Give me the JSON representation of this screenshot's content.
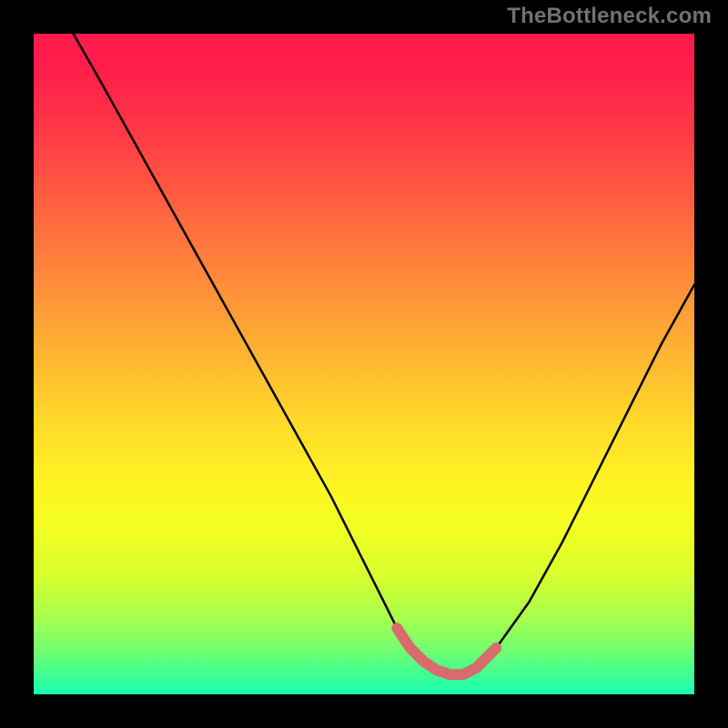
{
  "watermark": "TheBottleneck.com",
  "colors": {
    "background": "#000000",
    "curve": "#000000",
    "valley_marker": "#d86b6b",
    "gradient_top": "#ff1a4d",
    "gradient_mid": "#fff423",
    "gradient_bottom": "#18ffb0",
    "watermark": "#707172"
  },
  "chart_data": {
    "type": "line",
    "title": "",
    "xlabel": "",
    "ylabel": "",
    "xlim": [
      0,
      100
    ],
    "ylim": [
      0,
      100
    ],
    "grid": false,
    "legend": false,
    "series": [
      {
        "name": "bottleneck-curve",
        "x": [
          6,
          10,
          15,
          20,
          25,
          30,
          35,
          40,
          45,
          50,
          53,
          55,
          57,
          60,
          63,
          65,
          67,
          70,
          75,
          80,
          85,
          90,
          95,
          100
        ],
        "values": [
          100,
          93,
          84,
          75,
          66,
          57,
          48,
          39,
          30,
          20,
          14,
          10,
          7,
          4,
          3,
          3,
          4,
          7,
          14,
          23,
          33,
          43,
          53,
          62
        ]
      }
    ],
    "annotations": [
      {
        "name": "optimal-range-marker",
        "kind": "highlight-segment",
        "x_start": 55,
        "x_end": 70,
        "color": "#d86b6b"
      }
    ]
  }
}
